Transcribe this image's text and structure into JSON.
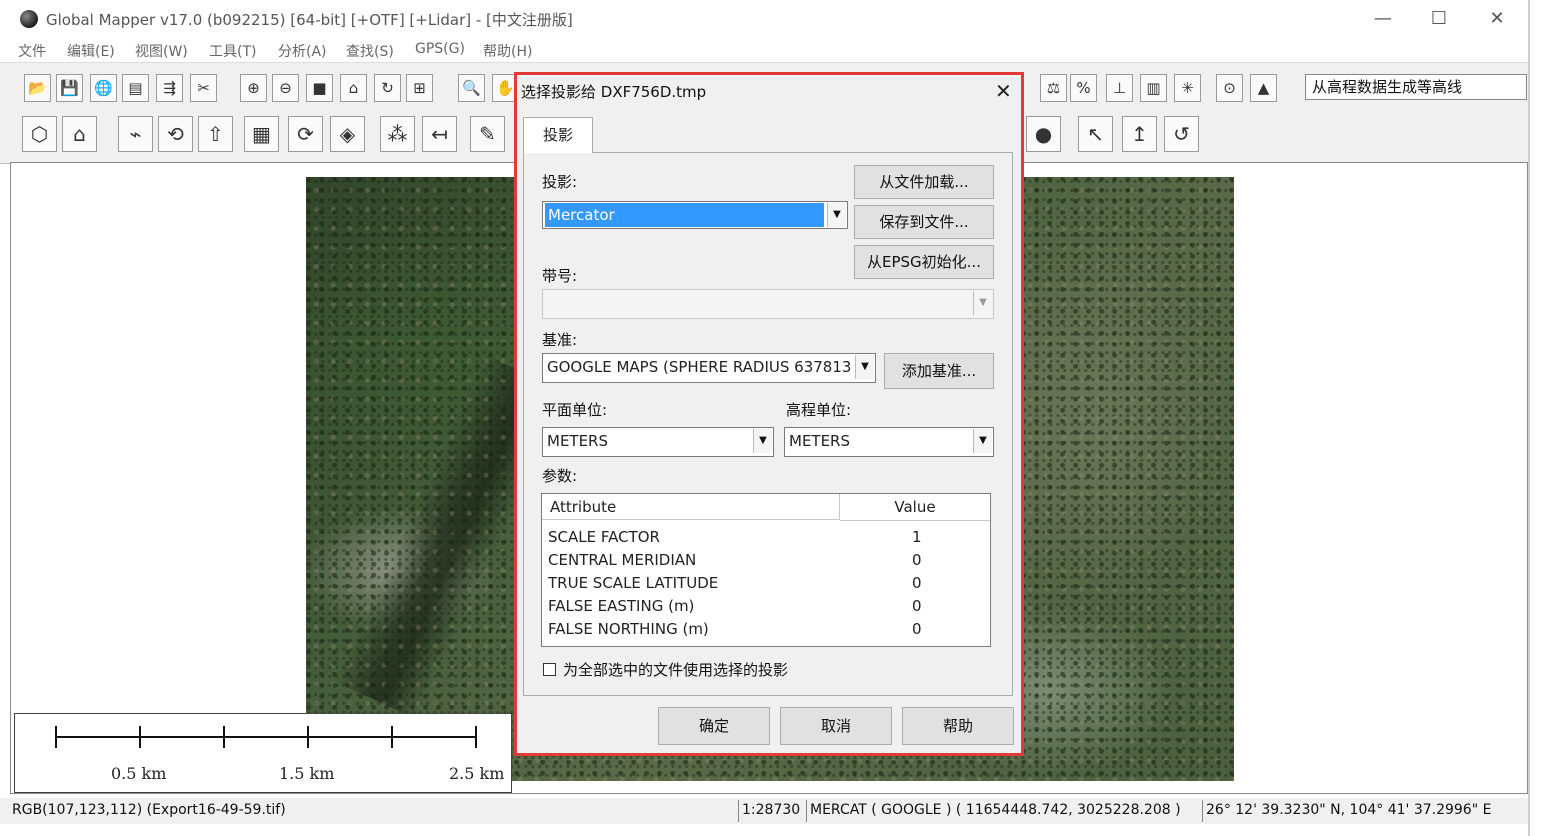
{
  "window": {
    "title": "Global Mapper v17.0 (b092215) [64-bit] [+OTF] [+Lidar] - [中文注册版]",
    "minimize": "—",
    "maximize": "☐",
    "close": "✕"
  },
  "menu": [
    "文件",
    "编辑(E)",
    "视图(W)",
    "工具(T)",
    "分析(A)",
    "查找(S)",
    "GPS(G)",
    "帮助(H)"
  ],
  "toolbar": {
    "combo_value": "从高程数据生成等高线",
    "row1_icons": [
      "open-folder-icon",
      "save-icon",
      "globe-icon",
      "layers-icon",
      "export-icon",
      "tools-icon",
      "zoom-in-icon",
      "zoom-out-icon",
      "stop-icon",
      "home-icon",
      "refresh-icon",
      "grid-icon",
      "magnifier-icon",
      "pan-icon",
      "scale-icon",
      "percent-icon",
      "profile-icon",
      "pages-icon",
      "star-icon",
      "target-icon",
      "north-arrow-icon"
    ],
    "row1_glyphs": [
      "📂",
      "💾",
      "🌐",
      "▤",
      "⇶",
      "✂",
      "⊕",
      "⊖",
      "■",
      "⌂",
      "↻",
      "⊞",
      "🔍",
      "✋",
      "⚖",
      "%",
      "⊥",
      "▥",
      "✳",
      "⊙",
      "▲"
    ],
    "row2_icons": [
      "digitize-area-icon",
      "digitize-line-icon",
      "edit-line-icon",
      "rotate-icon",
      "add-vertex-icon",
      "build-icon",
      "move-icon",
      "grid-feature-icon",
      "scatter-icon",
      "split-icon",
      "pen-icon",
      "blob-icon",
      "undo-icon",
      "redo-up-icon",
      "redo-icon"
    ],
    "row2_glyphs": [
      "⬡",
      "⌂",
      "⌁",
      "⟲",
      "⇧",
      "▦",
      "⟳",
      "◈",
      "⁂",
      "↤",
      "✎",
      "●",
      "↖",
      "↥",
      "↺"
    ]
  },
  "dialog": {
    "title": "选择投影给 DXF756D.tmp",
    "close": "✕",
    "tab": "投影",
    "projection_label": "投影:",
    "projection_value": "Mercator",
    "zone_label": "带号:",
    "zone_value": "",
    "datum_label": "基准:",
    "datum_value": "GOOGLE MAPS (SPHERE RADIUS 637813",
    "planar_units_label": "平面单位:",
    "planar_units_value": "METERS",
    "elev_units_label": "高程单位:",
    "elev_units_value": "METERS",
    "params_label": "参数:",
    "load_from_file": "从文件加载...",
    "save_to_file": "保存到文件...",
    "init_from_epsg": "从EPSG初始化...",
    "add_datum": "添加基准...",
    "table": {
      "headers": [
        "Attribute",
        "Value"
      ],
      "rows": [
        [
          "SCALE FACTOR",
          "1"
        ],
        [
          "CENTRAL MERIDIAN",
          "0"
        ],
        [
          "TRUE SCALE LATITUDE",
          "0"
        ],
        [
          "FALSE EASTING (m)",
          "0"
        ],
        [
          "FALSE NORTHING (m)",
          "0"
        ]
      ]
    },
    "apply_all_label": "为全部选中的文件使用选择的投影",
    "apply_all_checked": false,
    "ok": "确定",
    "cancel": "取消",
    "help": "帮助"
  },
  "scalebar": [
    "0.5 km",
    "1.5 km",
    "2.5 km"
  ],
  "status": {
    "pixel_info": "RGB(107,123,112) (Export16-49-59.tif)",
    "scale": "1:28730",
    "coords": "MERCAT ( GOOGLE ) ( 11654448.742, 3025228.208 )",
    "latlon": "26° 12' 39.3230\" N, 104° 41' 37.2996\" E"
  },
  "colors": {
    "dialog_border": "#e03a3a",
    "selection": "#3399ff"
  }
}
